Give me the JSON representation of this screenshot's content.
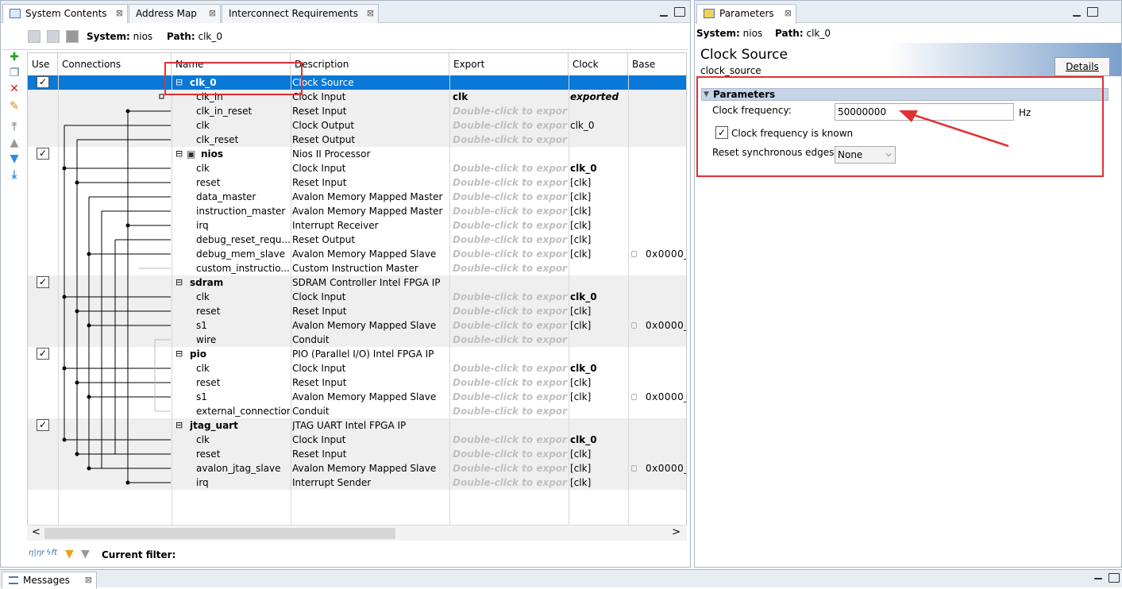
{
  "left_panel": {
    "tabs": [
      {
        "label": "System Contents",
        "active": true
      },
      {
        "label": "Address Map",
        "active": false
      },
      {
        "label": "Interconnect Requirements",
        "active": false
      }
    ],
    "system_label": "System:",
    "system_value": "nios",
    "path_label": "Path:",
    "path_value": "clk_0",
    "columns": [
      "Use",
      "Connections",
      "Name",
      "Description",
      "Export",
      "Clock",
      "Base"
    ],
    "rows": [
      {
        "type": "module",
        "name": "clk_0",
        "desc": "Clock Source",
        "export": "",
        "clock": "",
        "base": "",
        "checked": true,
        "selected": true
      },
      {
        "type": "port",
        "name": "clk_in",
        "desc": "Clock Input",
        "export": "clk",
        "exp_style": "bold",
        "clock": "exported",
        "clock_style": "bolditalic",
        "base": ""
      },
      {
        "type": "port",
        "name": "clk_in_reset",
        "desc": "Reset Input",
        "export": "Double-click to export",
        "exp_style": "dim",
        "clock": "",
        "base": ""
      },
      {
        "type": "port",
        "name": "clk",
        "desc": "Clock Output",
        "export": "Double-click to export",
        "exp_style": "dim",
        "clock": "clk_0",
        "base": ""
      },
      {
        "type": "port",
        "name": "clk_reset",
        "desc": "Reset Output",
        "export": "Double-click to export",
        "exp_style": "dim",
        "clock": "",
        "base": ""
      },
      {
        "type": "module",
        "name": "nios",
        "desc": "Nios II Processor",
        "export": "",
        "clock": "",
        "base": "",
        "checked": true,
        "has_icon": true
      },
      {
        "type": "port",
        "name": "clk",
        "desc": "Clock Input",
        "export": "Double-click to export",
        "exp_style": "dim",
        "clock": "clk_0",
        "clock_style": "bold",
        "base": ""
      },
      {
        "type": "port",
        "name": "reset",
        "desc": "Reset Input",
        "export": "Double-click to export",
        "exp_style": "dim",
        "clock": "[clk]",
        "base": ""
      },
      {
        "type": "port",
        "name": "data_master",
        "desc": "Avalon Memory Mapped Master",
        "export": "Double-click to export",
        "exp_style": "dim",
        "clock": "[clk]",
        "base": ""
      },
      {
        "type": "port",
        "name": "instruction_master",
        "desc": "Avalon Memory Mapped Master",
        "export": "Double-click to export",
        "exp_style": "dim",
        "clock": "[clk]",
        "base": ""
      },
      {
        "type": "port",
        "name": "irq",
        "desc": "Interrupt Receiver",
        "export": "Double-click to export",
        "exp_style": "dim",
        "clock": "[clk]",
        "base": ""
      },
      {
        "type": "port",
        "name": "debug_reset_requ...",
        "desc": "Reset Output",
        "export": "Double-click to export",
        "exp_style": "dim",
        "clock": "[clk]",
        "base": ""
      },
      {
        "type": "port",
        "name": "debug_mem_slave",
        "desc": "Avalon Memory Mapped Slave",
        "export": "Double-click to export",
        "exp_style": "dim",
        "clock": "[clk]",
        "base": "0x0000_",
        "lock": true
      },
      {
        "type": "port",
        "name": "custom_instructio...",
        "desc": "Custom Instruction Master",
        "export": "Double-click to export",
        "exp_style": "dim",
        "clock": "",
        "base": ""
      },
      {
        "type": "module",
        "name": "sdram",
        "desc": "SDRAM Controller Intel FPGA IP",
        "export": "",
        "clock": "",
        "base": "",
        "checked": true
      },
      {
        "type": "port",
        "name": "clk",
        "desc": "Clock Input",
        "export": "Double-click to export",
        "exp_style": "dim",
        "clock": "clk_0",
        "clock_style": "bold",
        "base": ""
      },
      {
        "type": "port",
        "name": "reset",
        "desc": "Reset Input",
        "export": "Double-click to export",
        "exp_style": "dim",
        "clock": "[clk]",
        "base": ""
      },
      {
        "type": "port",
        "name": "s1",
        "desc": "Avalon Memory Mapped Slave",
        "export": "Double-click to export",
        "exp_style": "dim",
        "clock": "[clk]",
        "base": "0x0000_",
        "lock": true
      },
      {
        "type": "port",
        "name": "wire",
        "desc": "Conduit",
        "export": "Double-click to export",
        "exp_style": "dim",
        "clock": "",
        "base": ""
      },
      {
        "type": "module",
        "name": "pio",
        "desc": "PIO (Parallel I/O) Intel FPGA IP",
        "export": "",
        "clock": "",
        "base": "",
        "checked": true
      },
      {
        "type": "port",
        "name": "clk",
        "desc": "Clock Input",
        "export": "Double-click to export",
        "exp_style": "dim",
        "clock": "clk_0",
        "clock_style": "bold",
        "base": ""
      },
      {
        "type": "port",
        "name": "reset",
        "desc": "Reset Input",
        "export": "Double-click to export",
        "exp_style": "dim",
        "clock": "[clk]",
        "base": ""
      },
      {
        "type": "port",
        "name": "s1",
        "desc": "Avalon Memory Mapped Slave",
        "export": "Double-click to export",
        "exp_style": "dim",
        "clock": "[clk]",
        "base": "0x0000_",
        "lock": true
      },
      {
        "type": "port",
        "name": "external_connection",
        "desc": "Conduit",
        "export": "Double-click to export",
        "exp_style": "dim",
        "clock": "",
        "base": ""
      },
      {
        "type": "module",
        "name": "jtag_uart",
        "desc": "JTAG UART Intel FPGA IP",
        "export": "",
        "clock": "",
        "base": "",
        "checked": true
      },
      {
        "type": "port",
        "name": "clk",
        "desc": "Clock Input",
        "export": "Double-click to export",
        "exp_style": "dim",
        "clock": "clk_0",
        "clock_style": "bold",
        "base": ""
      },
      {
        "type": "port",
        "name": "reset",
        "desc": "Reset Input",
        "export": "Double-click to export",
        "exp_style": "dim",
        "clock": "[clk]",
        "base": ""
      },
      {
        "type": "port",
        "name": "avalon_jtag_slave",
        "desc": "Avalon Memory Mapped Slave",
        "export": "Double-click to export",
        "exp_style": "dim",
        "clock": "[clk]",
        "base": "0x0000_",
        "lock": true
      },
      {
        "type": "port",
        "name": "irq",
        "desc": "Interrupt Sender",
        "export": "Double-click to export",
        "exp_style": "dim",
        "clock": "[clk]",
        "base": ""
      }
    ],
    "filter_label": "Current filter:",
    "scroll_left": "<",
    "scroll_right": ">"
  },
  "right_panel": {
    "tab_label": "Parameters",
    "system_label": "System:",
    "system_value": "nios",
    "path_label": "Path:",
    "path_value": "clk_0",
    "title": "Clock Source",
    "subtitle": "clock_source",
    "details_button": "Details",
    "section_title": "Parameters",
    "clock_freq_label": "Clock frequency:",
    "clock_freq_value": "50000000",
    "clock_freq_unit": "Hz",
    "known_label": "Clock frequency is known",
    "known_checked": true,
    "reset_sync_label": "Reset synchronous edges:",
    "reset_sync_value": "None"
  },
  "messages_tab": "Messages",
  "colors": {
    "selection": "#0a78d7",
    "annotation_red": "#e03131",
    "section_bg": "#c5d4e6"
  }
}
